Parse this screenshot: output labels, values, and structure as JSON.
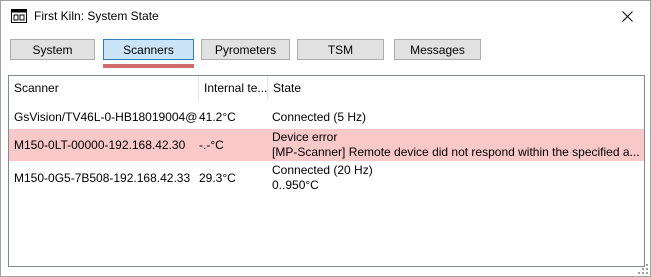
{
  "window": {
    "title": "First Kiln: System State"
  },
  "icons": {
    "app": "app-window-icon",
    "close": "close-icon",
    "resize": "resize-grip-icon"
  },
  "tabs": [
    {
      "label": "System",
      "active": false
    },
    {
      "label": "Scanners",
      "active": true
    },
    {
      "label": "Pyrometers",
      "active": false
    },
    {
      "label": "TSM",
      "active": false
    },
    {
      "label": "Messages",
      "active": false
    }
  ],
  "table": {
    "columns": [
      "Scanner",
      "Internal te...",
      "State"
    ],
    "rows": [
      {
        "scanner": "GsVision/TV46L-0-HB18019004@...",
        "temp": "41.2°C",
        "state_line1": "Connected (5 Hz)",
        "state_line2": "",
        "status": "ok"
      },
      {
        "scanner": "M150-0LT-00000-192.168.42.30",
        "temp": "-.-°C",
        "state_line1": "Device error",
        "state_line2": "[MP-Scanner] Remote device did not respond within the specified a...",
        "status": "error"
      },
      {
        "scanner": "M150-0G5-7B508-192.168.42.33",
        "temp": "29.3°C",
        "state_line1": "Connected (20 Hz)",
        "state_line2": "0..950°C",
        "status": "ok"
      }
    ]
  },
  "colors": {
    "error_row": "#f9c8c8",
    "active_tab": "#cce4f7",
    "tab_underline": "#d06c6c"
  }
}
